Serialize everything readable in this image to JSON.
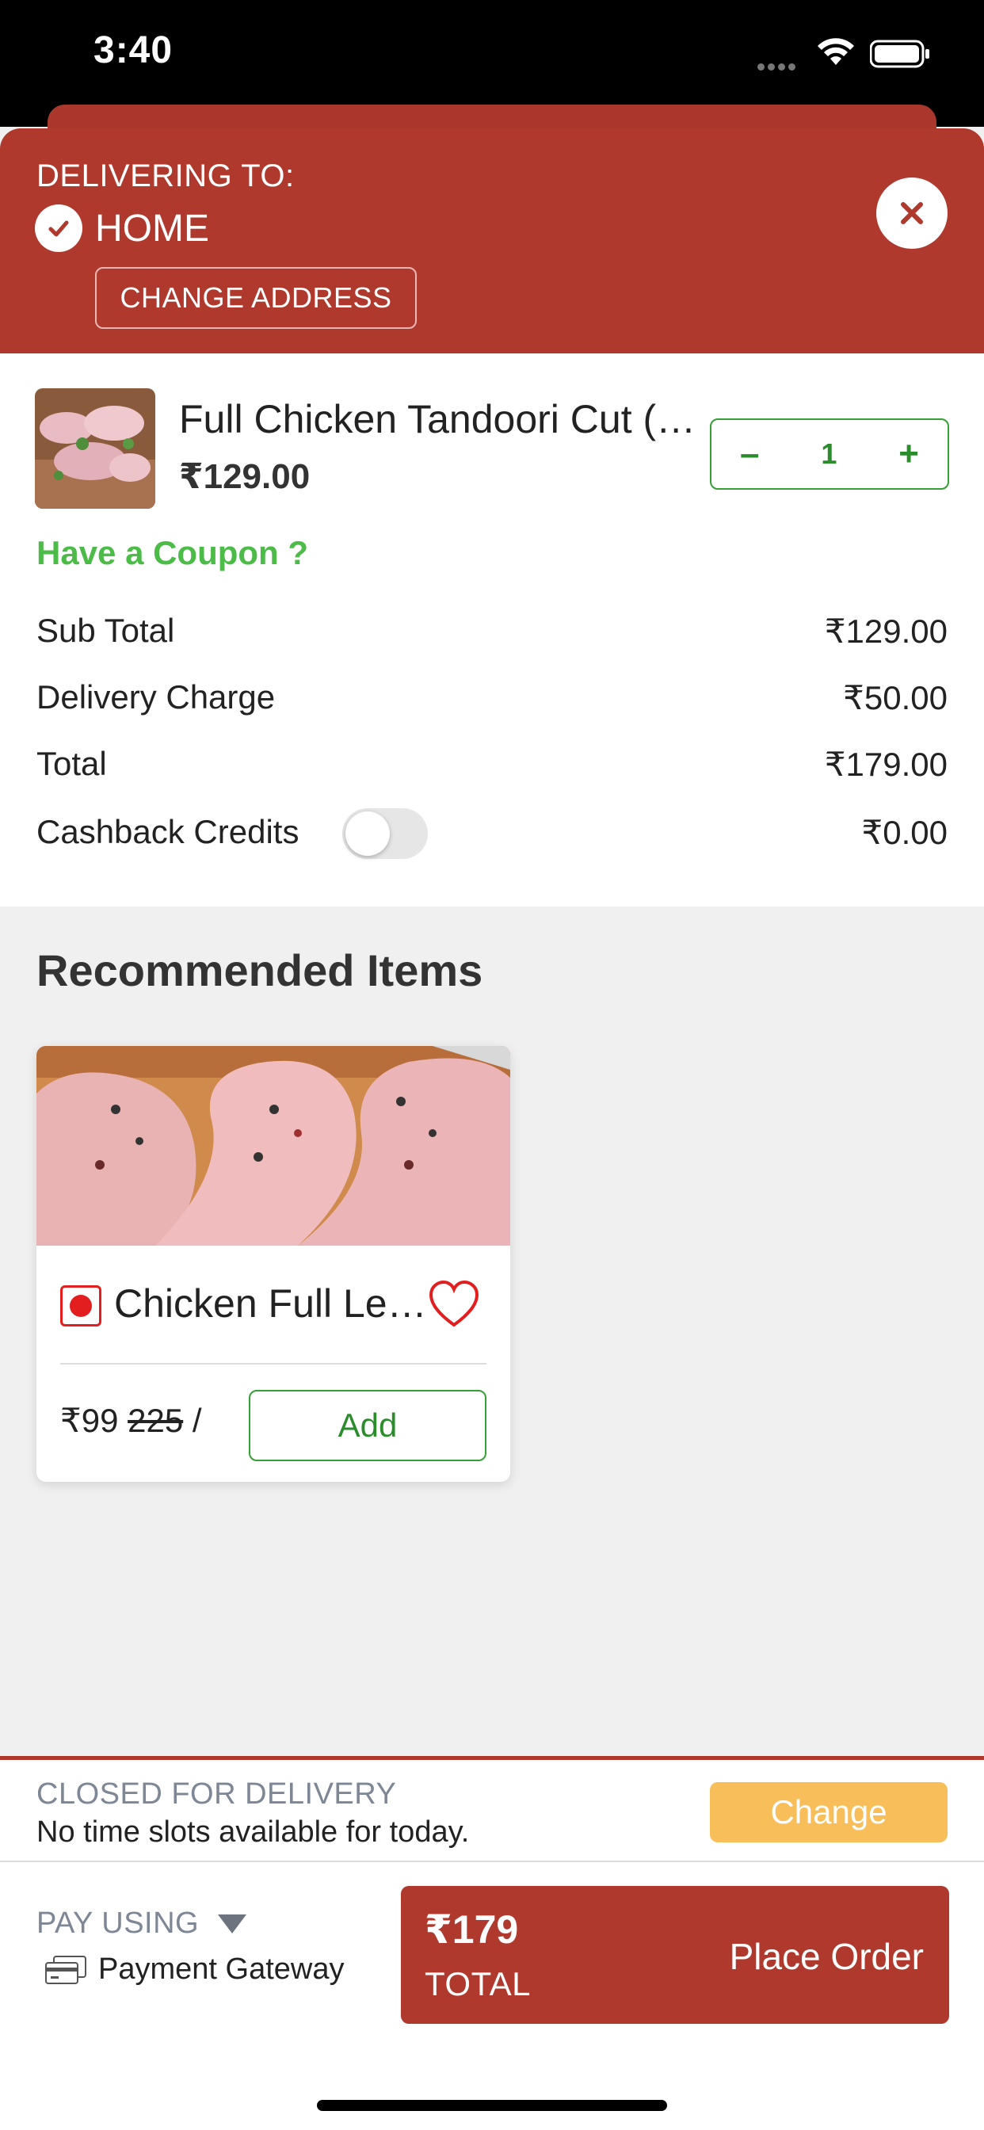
{
  "status_bar": {
    "time": "3:40"
  },
  "header": {
    "delivering_label": "DELIVERING TO:",
    "address_name": "HOME",
    "change_address_label": "CHANGE ADDRESS"
  },
  "cart": {
    "item": {
      "name": "Full Chicken Tandoori Cut (…",
      "price": "₹129.00",
      "quantity": "1",
      "minus": "–",
      "plus": "+"
    },
    "coupon_label": "Have a Coupon ?",
    "summary": {
      "sub_total_label": "Sub Total",
      "sub_total_value": "₹129.00",
      "delivery_label": "Delivery Charge",
      "delivery_value": "₹50.00",
      "total_label": "Total",
      "total_value": "₹179.00",
      "cashback_label": "Cashback Credits",
      "cashback_value": "₹0.00",
      "cashback_enabled": false
    }
  },
  "recommended": {
    "title": "Recommended Items",
    "items": [
      {
        "name": "Chicken Full Le…",
        "price": "₹99",
        "original_price": "225",
        "unit_sep": "/",
        "add_label": "Add"
      }
    ]
  },
  "delivery_notice": {
    "title": "CLOSED FOR DELIVERY",
    "subtitle": "No time slots available for today.",
    "change_label": "Change"
  },
  "payment": {
    "pay_using_label": "PAY USING",
    "method": "Payment Gateway",
    "total_amount": "₹179",
    "total_label": "TOTAL",
    "place_order_label": "Place Order"
  },
  "colors": {
    "brand_red": "#b0392e",
    "accent_green": "#35a035",
    "coupon_green": "#4cbb48",
    "change_yellow": "#f7be5a"
  }
}
